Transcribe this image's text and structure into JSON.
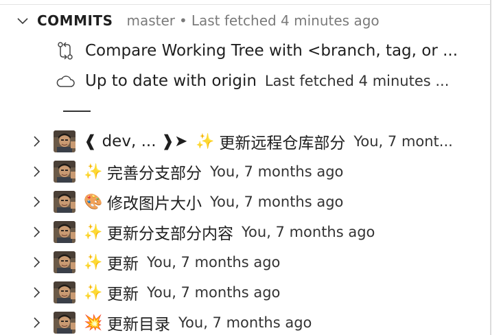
{
  "header": {
    "title": "COMMITS",
    "branch": "master",
    "separator": "•",
    "fetched": "Last fetched 4 minutes ago"
  },
  "actions": [
    {
      "icon": "compare-icon",
      "label": "Compare Working Tree with <branch, tag, or ...",
      "sub": ""
    },
    {
      "icon": "cloud-icon",
      "label": "Up to date with origin",
      "sub": "Last fetched 4 minutes ..."
    }
  ],
  "commits": [
    {
      "refs": "❰ dev, ... ❱➤",
      "emoji": "✨",
      "message": "更新远程仓库部分",
      "author": "You, 7 mont..."
    },
    {
      "refs": "",
      "emoji": "✨",
      "message": "完善分支部分",
      "author": "You, 7 months ago"
    },
    {
      "refs": "",
      "emoji": "🎨",
      "message": "修改图片大小",
      "author": "You, 7 months ago"
    },
    {
      "refs": "",
      "emoji": "✨",
      "message": "更新分支部分内容",
      "author": "You, 7 months ago"
    },
    {
      "refs": "",
      "emoji": "✨",
      "message": "更新",
      "author": "You, 7 months ago"
    },
    {
      "refs": "",
      "emoji": "✨",
      "message": "更新",
      "author": "You, 7 months ago"
    },
    {
      "refs": "",
      "emoji": "💥",
      "message": "更新目录",
      "author": "You, 7 months ago"
    }
  ]
}
